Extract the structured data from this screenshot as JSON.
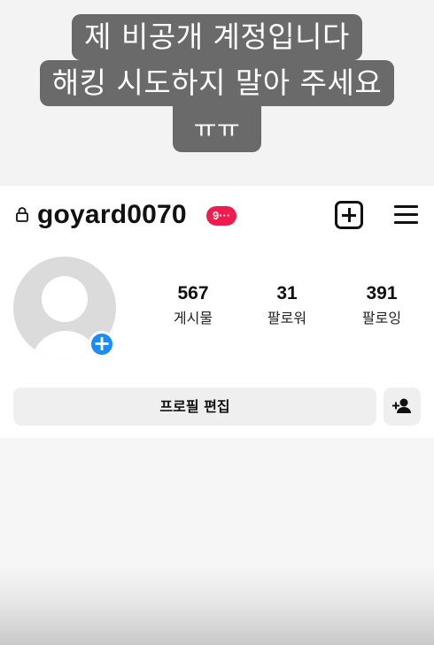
{
  "caption": {
    "line1": "제 비공개 계정입니다",
    "line2": "해킹 시도하지 말아 주세요",
    "line3": "ㅠㅠ"
  },
  "profile": {
    "username": "goyard0070",
    "notification_badge": "9···",
    "stats": [
      {
        "count": "567",
        "label": "게시물"
      },
      {
        "count": "31",
        "label": "팔로워"
      },
      {
        "count": "391",
        "label": "팔로잉"
      }
    ],
    "edit_profile_label": "프로필 편집"
  },
  "icons": {
    "lock": "lock-icon",
    "new_post": "plus-square-icon",
    "menu": "hamburger-menu-icon",
    "add_story": "plus-circle-icon",
    "add_friend": "add-person-icon"
  },
  "colors": {
    "caption_bg": "#6a6a6a",
    "badge": "#ee1d4f",
    "add_story": "#1a8cf3",
    "button_bg": "#efefef"
  }
}
